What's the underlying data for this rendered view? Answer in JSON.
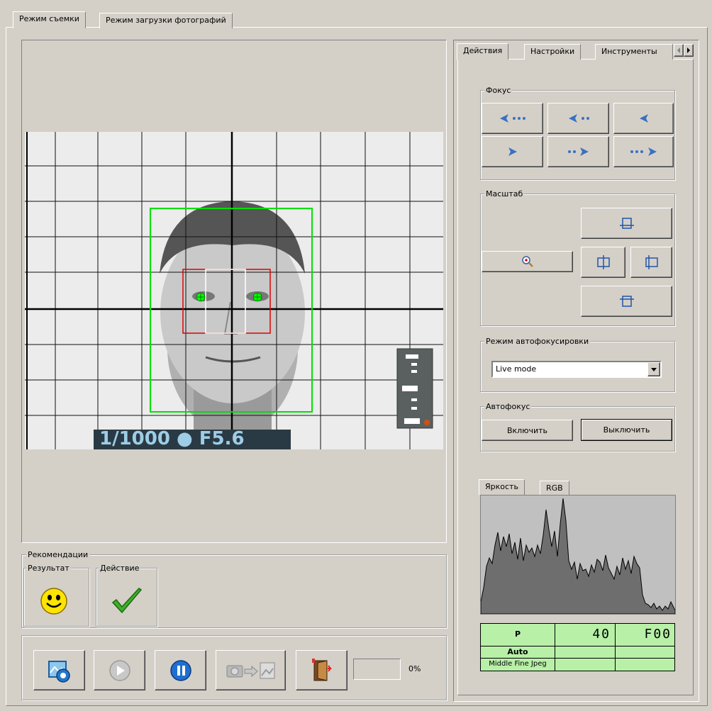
{
  "main_tabs": [
    {
      "label": "Режим съемки"
    },
    {
      "label": "Режим загрузки фотографий"
    }
  ],
  "preview": {
    "exposure_overlay": "1/1000 ● F5.6"
  },
  "recommendations": {
    "title": "Рекомендации",
    "result_label": "Результат",
    "action_label": "Действие"
  },
  "toolbar": {
    "progress_text": "0%"
  },
  "right_tabs": [
    {
      "label": "Действия"
    },
    {
      "label": "Настройки"
    },
    {
      "label": "Инструменты"
    }
  ],
  "focus": {
    "title": "Фокус"
  },
  "scale": {
    "title": "Масштаб"
  },
  "af_mode": {
    "title": "Режим автофокусировки",
    "selected": "Live mode"
  },
  "autofocus": {
    "title": "Автофокус",
    "on_label": "Включить",
    "off_label": "Выключить"
  },
  "histogram": {
    "tabs": [
      {
        "label": "Яркость"
      },
      {
        "label": "RGB"
      }
    ],
    "info": {
      "mode": "P",
      "shutter": "40",
      "aperture": "F00",
      "wb": "Auto",
      "quality": "Middle Fine Jpeg"
    }
  },
  "colors": {
    "face_box": "#00e000",
    "eyes_box": "#e00000",
    "histogram_fill": "#6e6e6e",
    "info_bg": "#b8f0a8"
  }
}
